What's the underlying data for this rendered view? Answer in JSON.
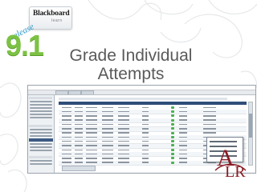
{
  "slide": {
    "title": "Grade Individual Attempts",
    "badge": {
      "brand": "Blackboard",
      "tagline": "learn",
      "release_word": "release",
      "version": "9.1"
    },
    "corner_logo_alt": "ALR"
  },
  "colors": {
    "title": "#5a5a5a",
    "version_green": "#7cc243",
    "release_blue": "#2b95c8",
    "logo_red": "#8a1c24",
    "nav_blue": "#2f4e78"
  }
}
